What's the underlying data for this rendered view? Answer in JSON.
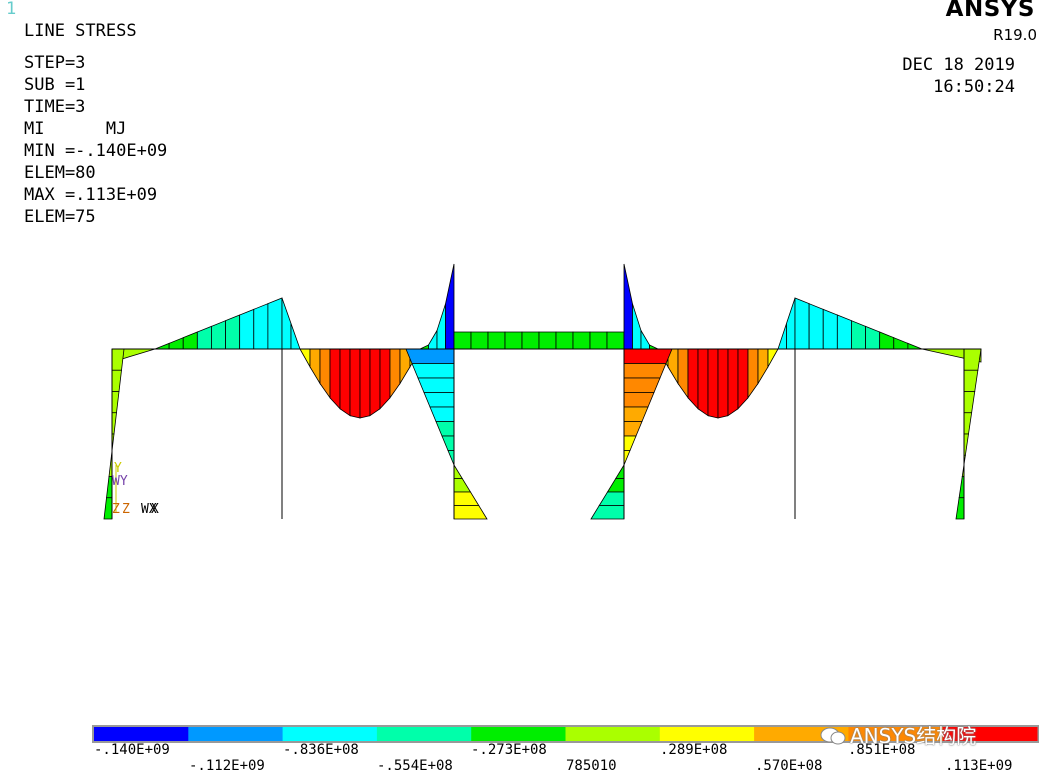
{
  "header": {
    "window_number": "1",
    "title": "LINE STRESS",
    "brand": "ANSYS",
    "version": "R19.0",
    "date": "DEC 18 2019",
    "time": "16:50:24"
  },
  "info_lines": [
    "STEP=3",
    "SUB =1",
    "TIME=3",
    "MI      MJ",
    "MIN =-.140E+09",
    "ELEM=80",
    "MAX =.113E+09",
    "ELEM=75"
  ],
  "triad": {
    "y": "Y",
    "wy": "WY",
    "z": "Z",
    "wz": "Z",
    "wx": "WX",
    "x": "X"
  },
  "legend": {
    "colors": [
      "#0000ff",
      "#0099ff",
      "#00ffff",
      "#00ffaa",
      "#00ee00",
      "#aaff00",
      "#ffff00",
      "#ffaa00",
      "#ff8800",
      "#ff0000"
    ],
    "labels_top": [
      ".140E+09",
      "-.836E+08",
      "-.273E+08",
      ".289E+08",
      ".851E+08"
    ],
    "labels_top_signs": [
      "-",
      "",
      "",
      "",
      ""
    ],
    "labels_bottom": [
      "-.112E+09",
      "-.554E+08",
      "785010",
      ".570E+08",
      ".113E+09"
    ]
  },
  "legend_top_text": [
    "-.140E+09",
    "-.836E+08",
    "-.273E+08",
    ".289E+08",
    ".851E+08"
  ],
  "watermark": "ANSYS结构院",
  "colors": {
    "accent_text": "#66cccc",
    "triad_y": "#cccc00",
    "triad_w": "#7744aa",
    "triad_z": "#cc6600"
  }
}
